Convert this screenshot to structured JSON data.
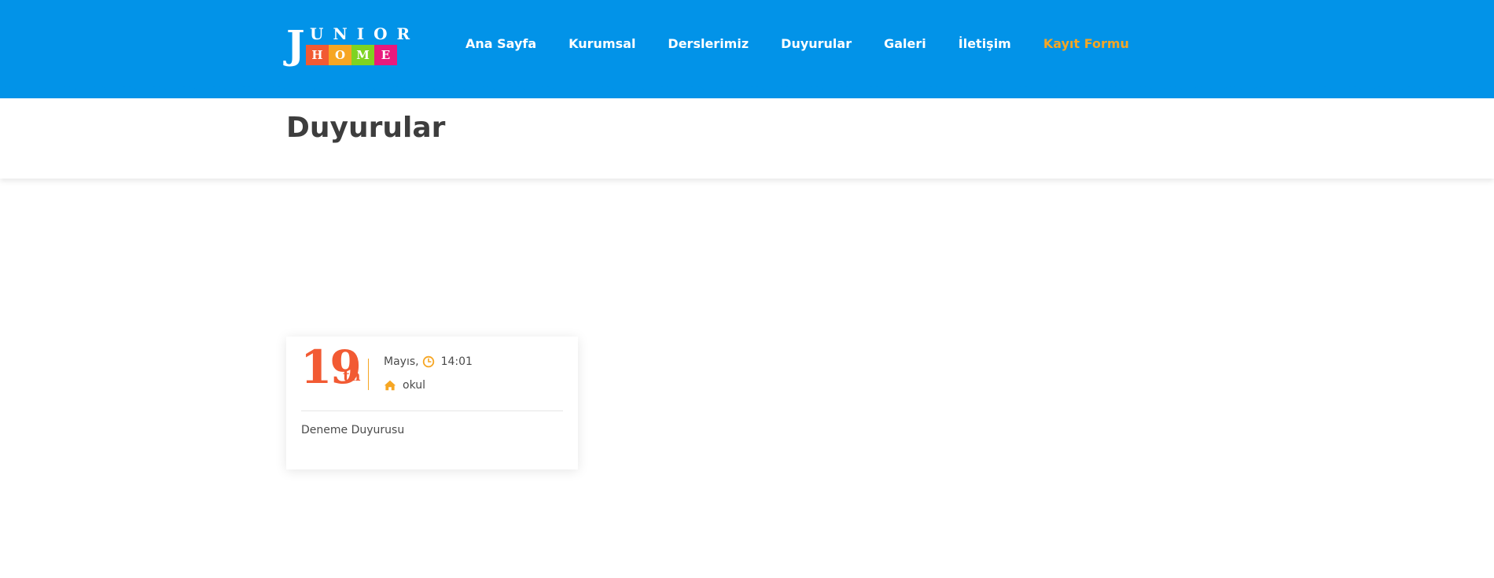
{
  "header": {
    "logo": {
      "letter_j": "J",
      "top_text": "UNIOR",
      "tiles": [
        {
          "letter": "H",
          "color": "#f25a33"
        },
        {
          "letter": "O",
          "color": "#f6a623"
        },
        {
          "letter": "M",
          "color": "#7ed321"
        },
        {
          "letter": "E",
          "color": "#e8197d"
        }
      ]
    },
    "nav": [
      {
        "label": "Ana Sayfa",
        "active": false
      },
      {
        "label": "Kurumsal",
        "active": false
      },
      {
        "label": "Derslerimiz",
        "active": false
      },
      {
        "label": "Duyurular",
        "active": false
      },
      {
        "label": "Galeri",
        "active": false
      },
      {
        "label": "İletişim",
        "active": false
      },
      {
        "label": "Kayıt Formu",
        "active": true
      }
    ]
  },
  "page": {
    "title": "Duyurular"
  },
  "announcement": {
    "day": "19",
    "suffix": "th",
    "month": "Mayıs,",
    "clock_icon": "clock-icon",
    "time": "14:01",
    "home_icon": "home-icon",
    "category": "okul",
    "text": "Deneme Duyurusu"
  },
  "colors": {
    "header_blue": "#0293e8",
    "accent_orange": "#f6a623",
    "date_red": "#f25a33",
    "title_text": "#3d3d3d"
  }
}
